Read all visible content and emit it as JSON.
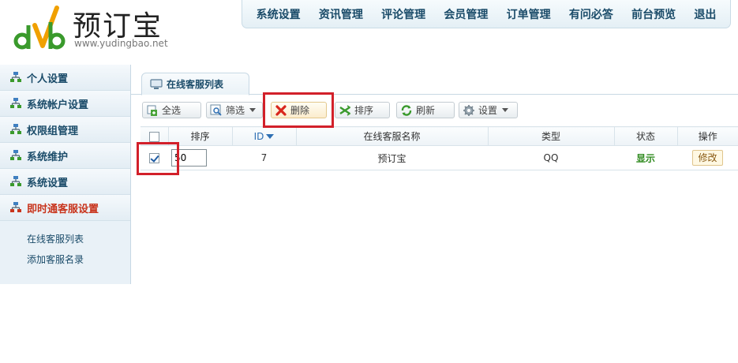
{
  "logo": {
    "text": "预订宝",
    "url": "www.yudingbao.net"
  },
  "topnav": {
    "items": [
      "系统设置",
      "资讯管理",
      "评论管理",
      "会员管理",
      "订单管理",
      "有问必答",
      "前台预览",
      "退出"
    ]
  },
  "sidebar": {
    "items": [
      {
        "label": "个人设置",
        "icon": "sitemap-icon"
      },
      {
        "label": "系统帐户设置",
        "icon": "sitemap-icon"
      },
      {
        "label": "权限组管理",
        "icon": "sitemap-icon"
      },
      {
        "label": "系统维护",
        "icon": "sitemap-icon"
      },
      {
        "label": "系统设置",
        "icon": "sitemap-icon"
      },
      {
        "label": "即时通客服设置",
        "icon": "sitemap-icon",
        "active": true
      }
    ],
    "sub_items": [
      "在线客服列表",
      "添加客服名录"
    ]
  },
  "tab": {
    "label": "在线客服列表"
  },
  "toolbar": {
    "select_all": "全选",
    "filter": "筛选",
    "delete": "删除",
    "sort": "排序",
    "refresh": "刷新",
    "settings": "设置"
  },
  "table": {
    "headers": {
      "sort": "排序",
      "id": "ID",
      "name": "在线客服名称",
      "type": "类型",
      "status": "状态",
      "action": "操作"
    },
    "rows": [
      {
        "checked": true,
        "sort": "50",
        "id": "7",
        "name": "预订宝",
        "type": "QQ",
        "status": "显示",
        "action": "修改"
      }
    ]
  },
  "colors": {
    "accent": "#1a4b69",
    "active": "#c8341c",
    "status_on": "#2f8a1f",
    "highlight": "#d2202a"
  }
}
